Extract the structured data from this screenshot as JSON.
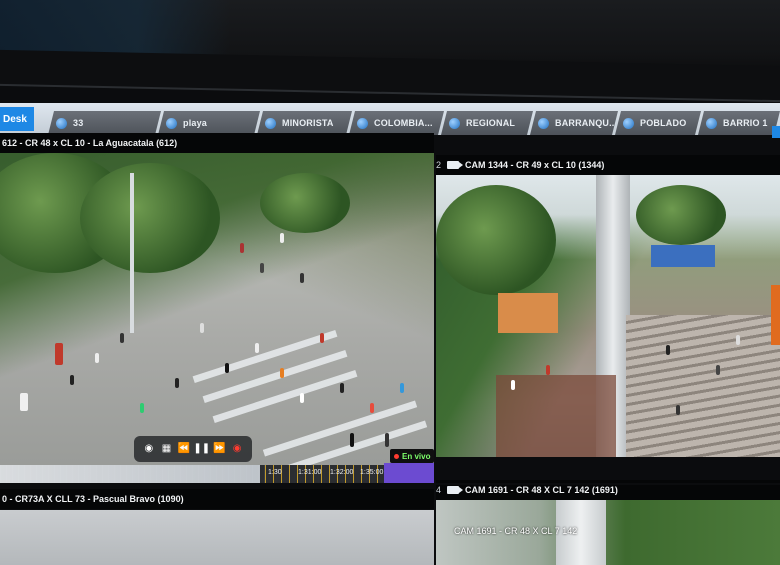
{
  "tabs": {
    "first": "Desk",
    "items": [
      {
        "label": "33"
      },
      {
        "label": "playa"
      },
      {
        "label": "MINORISTA"
      },
      {
        "label": "COLOMBIA..."
      },
      {
        "label": "REGIONAL"
      },
      {
        "label": "BARRANQU..."
      },
      {
        "label": "POBLADO"
      },
      {
        "label": "BARRIO 1"
      }
    ]
  },
  "cameras": [
    {
      "index": "",
      "label": "612 - CR 48 x CL 10 - La Aguacatala (612)"
    },
    {
      "index": "2",
      "label": "CAM 1344 - CR 49 x CL 10 (1344)"
    },
    {
      "index": "",
      "label": "0 - CR73A X CLL 73 - Pascual Bravo (1090)"
    },
    {
      "index": "4",
      "label": "CAM 1691 - CR 48 X CL 7 142 (1691)"
    }
  ],
  "video4_overlay": "CAM 1691 - CR 48 X CL 7 142",
  "playback": {
    "live_label": "En vivo",
    "time_marks": [
      "1:30",
      "1:31:00",
      "1:32:00",
      "1:35:00"
    ]
  }
}
